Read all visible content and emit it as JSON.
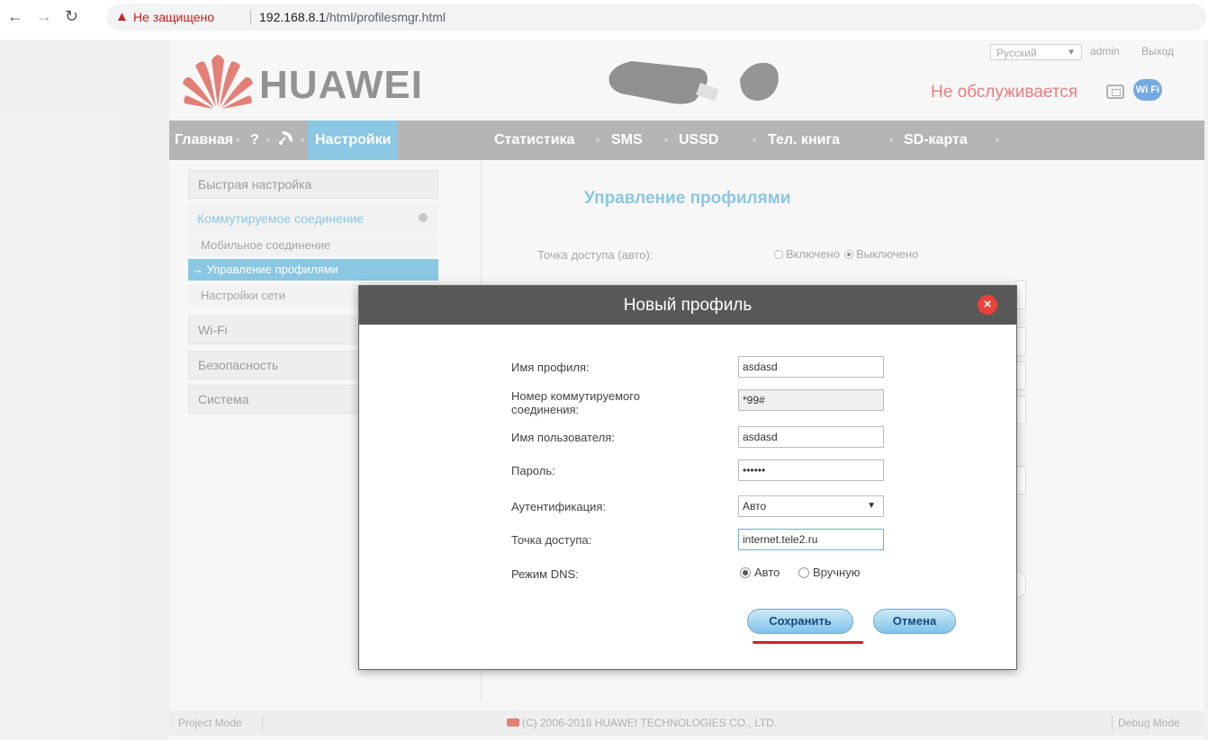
{
  "browser": {
    "warning": "Не защищено",
    "url_host": "192.168.8.1",
    "url_path": "/html/profilesmgr.html"
  },
  "header": {
    "logo_text": "HUAWEI",
    "language": "Русский",
    "user": "admin",
    "logout": "Выход",
    "service_status": "Не обслуживается",
    "wifi_badge": "Wi Fi"
  },
  "nav": {
    "items": [
      "Главная",
      "?",
      "Настройки",
      "Статистика",
      "SMS",
      "USSD",
      "Тел. книга",
      "SD-карта"
    ]
  },
  "sidebar": {
    "quick_setup": "Быстрая настройка",
    "dialup": "Коммутируемое соединение",
    "sub_items": [
      "Мобильное соединение",
      "→ Управление профилями",
      "Настройки сети"
    ],
    "wifi": "Wi-Fi",
    "security": "Безопасность",
    "system": "Система"
  },
  "main": {
    "title": "Управление профилями",
    "ap_auto_label": "Точка доступа (авто):",
    "ap_auto_on": "Включено",
    "ap_auto_off": "Выключено"
  },
  "dialog": {
    "title": "Новый профиль",
    "close": "×",
    "fields": {
      "profile_name_label": "Имя профиля:",
      "profile_name_value": "asdasd",
      "dial_number_label": "Номер коммутируемого соединения:",
      "dial_number_value": "*99#",
      "username_label": "Имя пользователя:",
      "username_value": "asdasd",
      "password_label": "Пароль:",
      "password_value": "••••••",
      "auth_label": "Аутентификация:",
      "auth_value": "Авто",
      "apn_label": "Точка доступа:",
      "apn_value": "internet.tele2.ru",
      "dns_label": "Режим DNS:",
      "dns_auto": "Авто",
      "dns_manual": "Вручную"
    },
    "save": "Сохранить",
    "cancel": "Отмена"
  },
  "footer": {
    "project_mode": "Project Mode",
    "copyright": "(C) 2006-2018 HUAWEI TECHNOLOGIES CO., LTD.",
    "debug_mode": "Debug Mode"
  },
  "colors": {
    "accent": "#4ca9d3",
    "status_red": "#e3363b",
    "nav_bg": "#8e8e8e",
    "dialog_header": "#585858",
    "highlight_underline": "#d21f2a"
  },
  "icons": [
    "back-arrow-icon",
    "forward-arrow-icon",
    "reload-icon",
    "warning-icon",
    "huawei-logo-icon",
    "usb-modem-image",
    "sim-icon",
    "wifi-icon",
    "satellite-icon",
    "close-icon",
    "collapse-icon",
    "chevron-down-icon"
  ]
}
